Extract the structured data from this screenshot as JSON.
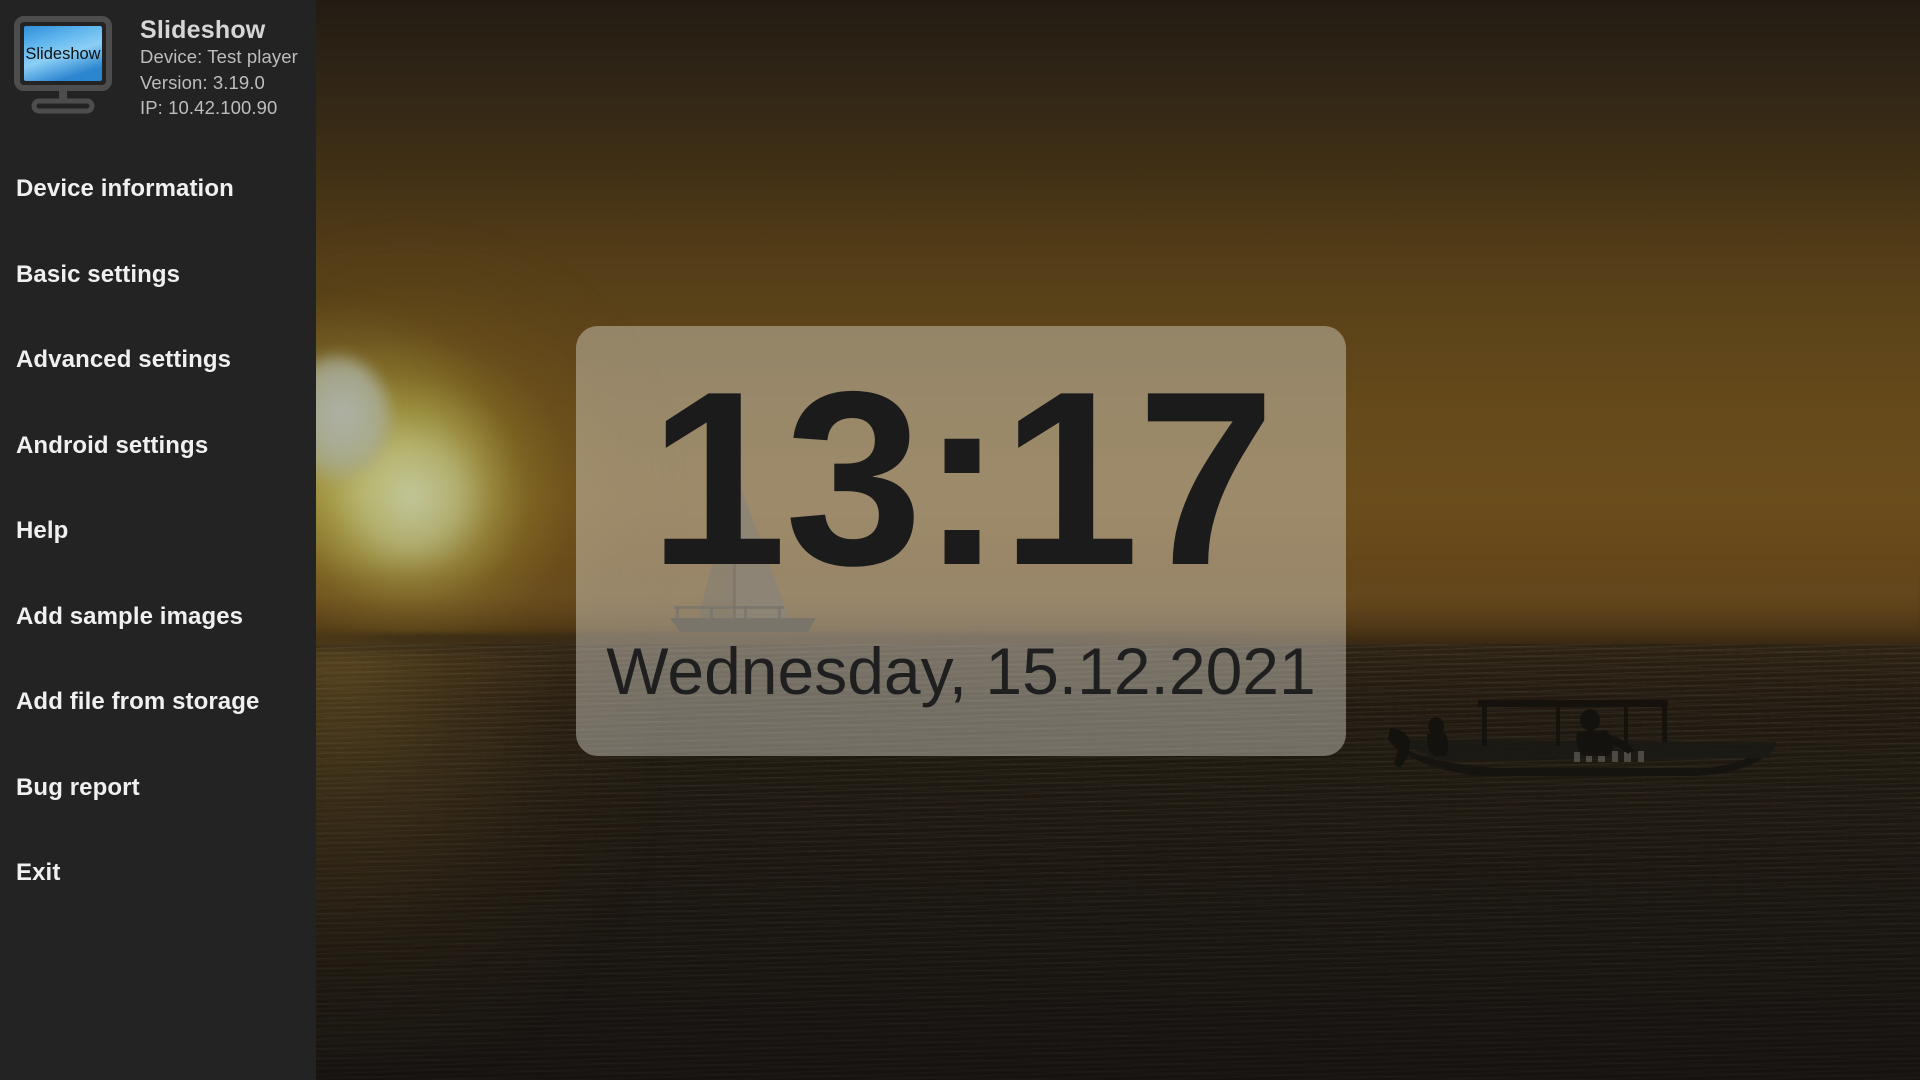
{
  "app": {
    "title": "Slideshow",
    "icon_name": "monitor-slideshow-icon",
    "icon_label": "Slideshow",
    "device_line": "Device: Test player",
    "version_line": "Version: 3.19.0",
    "ip_line": "IP: 10.42.100.90",
    "sidebar_bg": "#232323",
    "title_color": "#d6d6d6",
    "meta_color": "#bdbdbd",
    "menu_color": "#f0f0f0"
  },
  "menu": {
    "items": [
      {
        "label": "Device information",
        "name": "menu-item-device-information"
      },
      {
        "label": "Basic settings",
        "name": "menu-item-basic-settings"
      },
      {
        "label": "Advanced settings",
        "name": "menu-item-advanced-settings"
      },
      {
        "label": "Android settings",
        "name": "menu-item-android-settings"
      },
      {
        "label": "Help",
        "name": "menu-item-help"
      },
      {
        "label": "Add sample images",
        "name": "menu-item-add-sample-images"
      },
      {
        "label": "Add file from storage",
        "name": "menu-item-add-file-from-storage"
      },
      {
        "label": "Bug report",
        "name": "menu-item-bug-report"
      },
      {
        "label": "Exit",
        "name": "menu-item-exit"
      }
    ]
  },
  "overlay": {
    "time": "13:17",
    "date": "Wednesday, 15.12.2021",
    "panel_fill": "rgba(226,223,214,0.42)",
    "text_color": "#1b1b1b"
  },
  "background": {
    "scene": "sunset-over-sea-with-boats",
    "sky_top": "#241c13",
    "sky_glow": "#6b4d1c",
    "sea_color": "#201a12",
    "sun_color": "#c6ceb2"
  }
}
